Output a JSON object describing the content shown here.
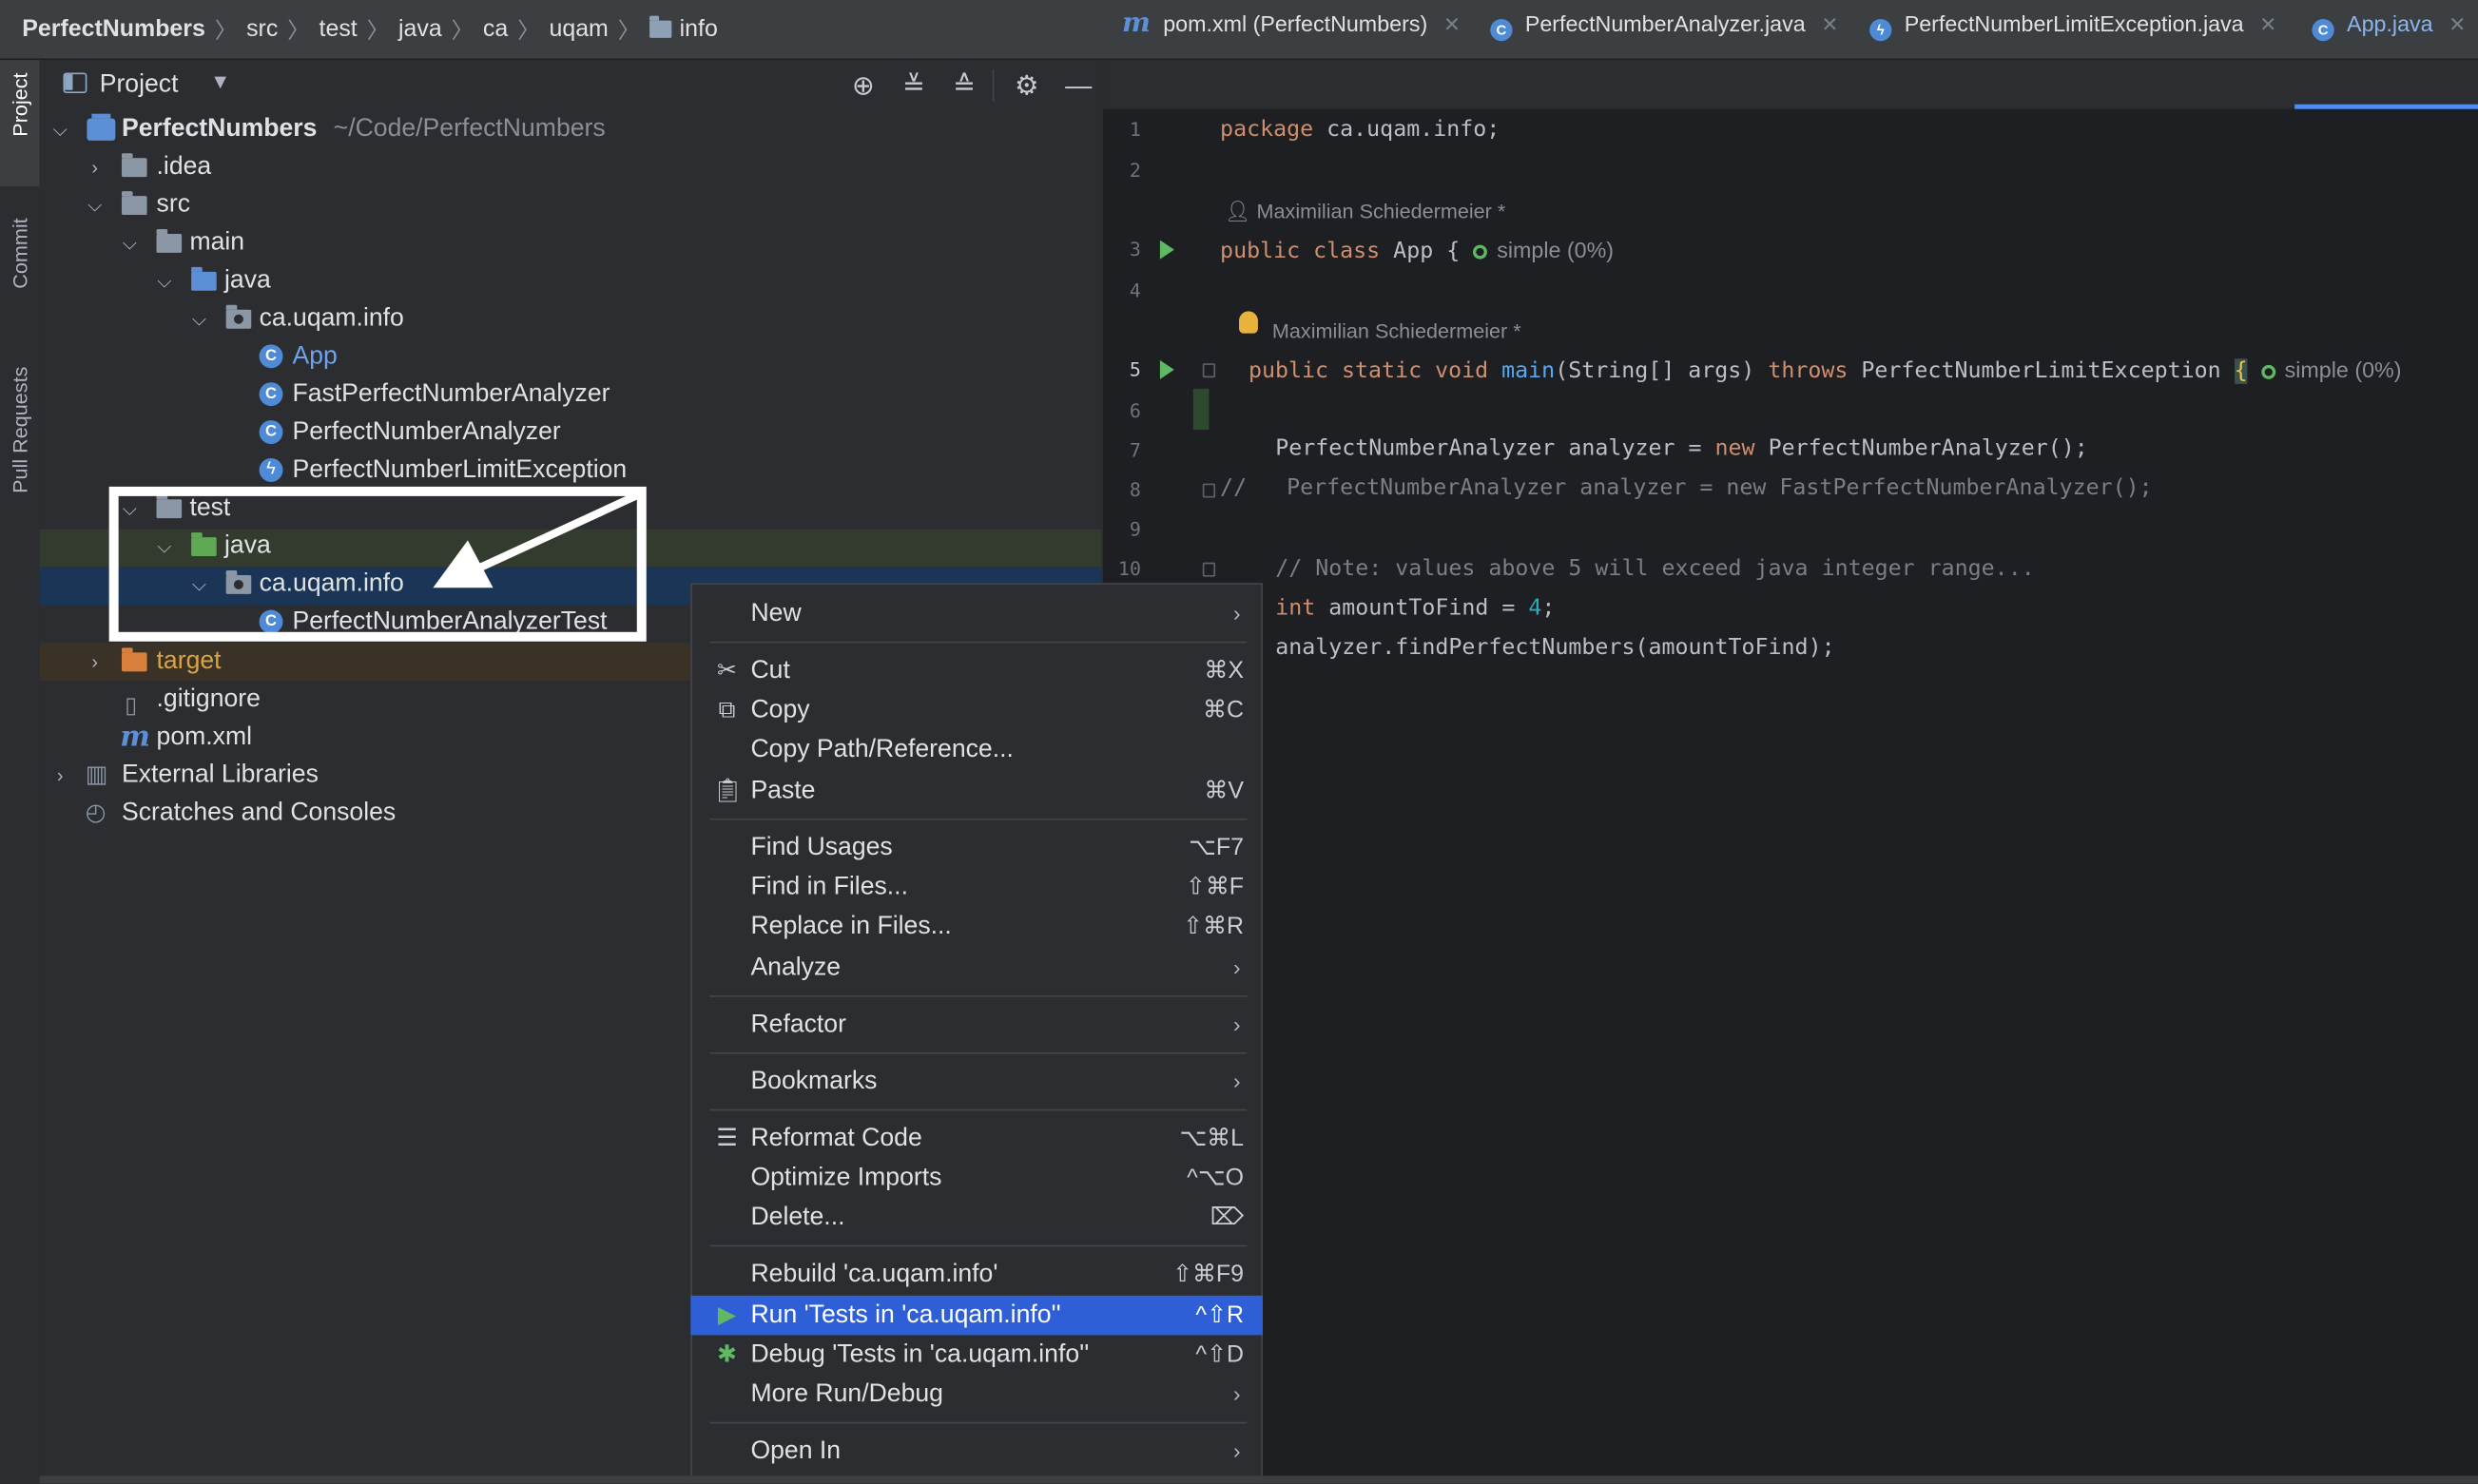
{
  "breadcrumb": [
    "PerfectNumbers",
    "src",
    "test",
    "java",
    "ca",
    "uqam",
    "info"
  ],
  "toolstrip": {
    "project": "Project",
    "commit": "Commit",
    "pull_requests": "Pull Requests"
  },
  "project_panel": {
    "title": "Project",
    "tree": {
      "root_name": "PerfectNumbers",
      "root_path": "~/Code/PerfectNumbers",
      "idea": ".idea",
      "src": "src",
      "main": "main",
      "main_java": "java",
      "main_pkg": "ca.uqam.info",
      "app": "App",
      "fast": "FastPerfectNumberAnalyzer",
      "analyzer": "PerfectNumberAnalyzer",
      "limit_exc": "PerfectNumberLimitException",
      "test": "test",
      "test_java": "java",
      "test_pkg": "ca.uqam.info",
      "test_class": "PerfectNumberAnalyzerTest",
      "target": "target",
      "gitignore": ".gitignore",
      "pom": "pom.xml",
      "ext_libs": "External Libraries",
      "scratches": "Scratches and Consoles"
    }
  },
  "tabs": [
    {
      "label": "pom.xml (PerfectNumbers)",
      "icon": "maven-icon"
    },
    {
      "label": "PerfectNumberAnalyzer.java",
      "icon": "class-icon"
    },
    {
      "label": "PerfectNumberLimitException.java",
      "icon": "exception-icon"
    },
    {
      "label": "App.java",
      "icon": "class-icon",
      "active": true
    }
  ],
  "editor": {
    "line_numbers": [
      "1",
      "2",
      "3",
      "4",
      "5",
      "6",
      "7",
      "8",
      "9",
      "10"
    ],
    "author_hint": "Maximilian Schiedermeier *",
    "coverage_hint": "simple (0%)",
    "code": {
      "l1_kw": "package",
      "l1_rest": " ca.uqam.info;",
      "l3_kw": "public class",
      "l3_rest": " App {",
      "l5_kw": "public static void",
      "l5_fn": "main",
      "l5_mid": "(String[] args) ",
      "l5_throws": "throws",
      "l5_rest": " PerfectNumberLimitException ",
      "l5_brace": "{",
      "l7_a": "PerfectNumberAnalyzer analyzer = ",
      "l7_new": "new",
      "l7_b": " PerfectNumberAnalyzer();",
      "l8": "//   PerfectNumberAnalyzer analyzer = new FastPerfectNumberAnalyzer();",
      "l10": "// Note: values above 5 will exceed java integer range...",
      "l11_kw": "int",
      "l11_a": " amountToFind = ",
      "l11_num": "4",
      "l11_b": ";",
      "l12": "analyzer.findPerfectNumbers(amountToFind);"
    }
  },
  "context_menu": {
    "new": "New",
    "cut": "Cut",
    "cut_sc": "⌘X",
    "copy": "Copy",
    "copy_sc": "⌘C",
    "copy_path": "Copy Path/Reference...",
    "paste": "Paste",
    "paste_sc": "⌘V",
    "find_usages": "Find Usages",
    "find_usages_sc": "⌥F7",
    "find_in_files": "Find in Files...",
    "find_in_files_sc": "⇧⌘F",
    "replace_in_files": "Replace in Files...",
    "replace_in_files_sc": "⇧⌘R",
    "analyze": "Analyze",
    "refactor": "Refactor",
    "bookmarks": "Bookmarks",
    "reformat": "Reformat Code",
    "reformat_sc": "⌥⌘L",
    "optimize": "Optimize Imports",
    "optimize_sc": "^⌥O",
    "delete": "Delete...",
    "delete_sc": "⌦",
    "rebuild": "Rebuild 'ca.uqam.info'",
    "rebuild_sc": "⇧⌘F9",
    "run_tests": "Run 'Tests in 'ca.uqam.info''",
    "run_tests_sc": "^⇧R",
    "debug_tests": "Debug 'Tests in 'ca.uqam.info''",
    "debug_tests_sc": "^⇧D",
    "more_run": "More Run/Debug",
    "open_in": "Open In"
  }
}
